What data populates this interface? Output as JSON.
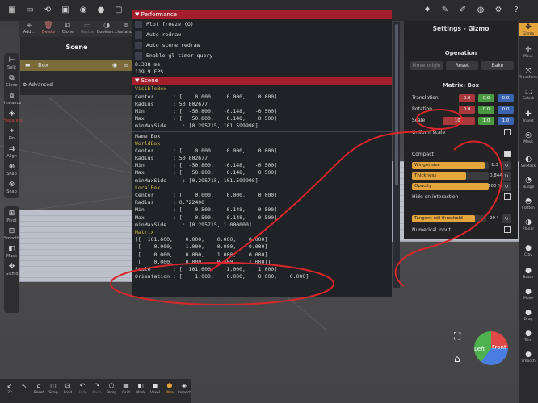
{
  "top_icons": [
    "grid-icon",
    "folder-icon",
    "share-icon",
    "image-icon",
    "camera-icon",
    "mic-icon",
    "screen-icon"
  ],
  "toolbar": {
    "items": [
      {
        "label": "Add...",
        "icon": "+"
      },
      {
        "label": "Delete",
        "icon": "🗑"
      },
      {
        "label": "Clone",
        "icon": "⧉"
      },
      {
        "label": "Resize",
        "icon": "▭"
      },
      {
        "label": "Boolean...",
        "icon": "◑"
      },
      {
        "label": "Instance",
        "icon": "⧈"
      }
    ]
  },
  "left_rail": {
    "items": [
      "Split",
      "Clone",
      "Instance",
      "Separate",
      "Pin",
      "Align",
      "Snap",
      "Snap"
    ],
    "items2": [
      "Pivot",
      "Smooth",
      "Mask",
      "Gizmo"
    ]
  },
  "scene": {
    "title": "Scene",
    "object_name": "Box",
    "advanced_label": "Advanced"
  },
  "performance": {
    "header": "Performance",
    "checks": [
      "Plot freeze (O)",
      "Auto redraw",
      "Auto scene redraw",
      "Enable gl timer query"
    ],
    "stats": [
      "8.338 ms",
      "119.9 FPS"
    ],
    "scene_header": "Scene",
    "visible_box": {
      "title": "VisibleBox",
      "lines": [
        "Center      : [    0.000,    0.000,    0.000]",
        "Radius      : 50.802677",
        "Min         : [  -50.800,   -0.148,   -0.500]",
        "Max         : [   50.800,    0.148,    0.500]",
        "minMaxSide     : [0.295715, 101.599998]"
      ]
    },
    "name_line": "Name Box",
    "world_box": {
      "title": "WorldBox",
      "lines": [
        "Center      : [    0.000,    0.000,    0.000]",
        "Radius      : 50.802677",
        "Min         : [  -50.800,   -0.148,   -0.500]",
        "Max         : [   50.800,    0.148,    0.500]",
        "minMaxSide     : [0.295715, 101.599998]"
      ]
    },
    "local_box": {
      "title": "LocalBox",
      "lines": [
        "Center      : [    0.000,    0.000,    0.000]",
        "Radius      : 0.722400",
        "Min         : [   -0.500,   -0.148,   -0.500]",
        "Max         : [    0.500,    0.148,    0.500]",
        "minMaxSide     : [0.295715, 1.000000]"
      ]
    },
    "matrix": {
      "title": "Matrix",
      "lines": [
        "[[  101.600,    0.000,    0.000,    0.000]",
        " [    0.000,    1.000,    0.000,    0.000]",
        " [    0.000,    0.000,    1.000,    0.000]",
        " [    0.000,    0.000,    0.000,    1.000]]"
      ]
    },
    "scale_line": "Scale       : [  101.600,    1.000,    1.000]",
    "orientation_line": "Orientation : [    1.000,    0.000,    0.000,    0.000]"
  },
  "settings": {
    "title": "Settings - Gizmo",
    "operation_label": "Operation",
    "move_origin": "Move origin",
    "reset": "Reset",
    "bake": "Bake",
    "matrix_title": "Matrix:  Box",
    "translation_label": "Translation",
    "rotation_label": "Rotation",
    "scale_label": "Scale",
    "translation": [
      "0.0",
      "0.0",
      "0.0"
    ],
    "rotation": [
      "0.0",
      "0.0",
      "0.0"
    ],
    "scale": [
      "102",
      "1.0",
      "1.0"
    ],
    "uniform_scale": "Uniform scale",
    "compact": "Compact",
    "widget_size_label": "Widget size",
    "widget_size_value": "1.3",
    "widget_size_level": 0.95,
    "thickness_label": "Thickness",
    "thickness_value": "0.844",
    "thickness_level": 0.7,
    "opacity_label": "Opacity",
    "opacity_value": "100 %",
    "opacity_level": 1.0,
    "hide_on_interaction": "Hide on interaction",
    "tangent_label": "Tangent roll threshold",
    "tangent_value": "90 °",
    "tangent_level": 0.85,
    "numerical_input": "Numerical input"
  },
  "right_rail": {
    "items": [
      "Gizmo",
      "Move",
      "Transform",
      "Select",
      "Insert",
      "Mask",
      "SelMask",
      "Nudge",
      "Flatten",
      "Planar",
      "Clay",
      "Brush",
      "Move",
      "Drag",
      "Trim",
      "Smooth"
    ]
  },
  "bottom": {
    "items": [
      "22",
      "",
      "Reset",
      "Snap",
      "Load",
      "Undo",
      "Redo",
      "Persp",
      "Grid",
      "Mask",
      "Voxel",
      "Wire",
      "Inspect"
    ]
  },
  "gizmo_ball": {
    "left": "Left",
    "front": "Front"
  },
  "colors": {
    "accent": "#e4a53d",
    "header_red": "#a51e2c",
    "annotation": "#d8262b"
  }
}
